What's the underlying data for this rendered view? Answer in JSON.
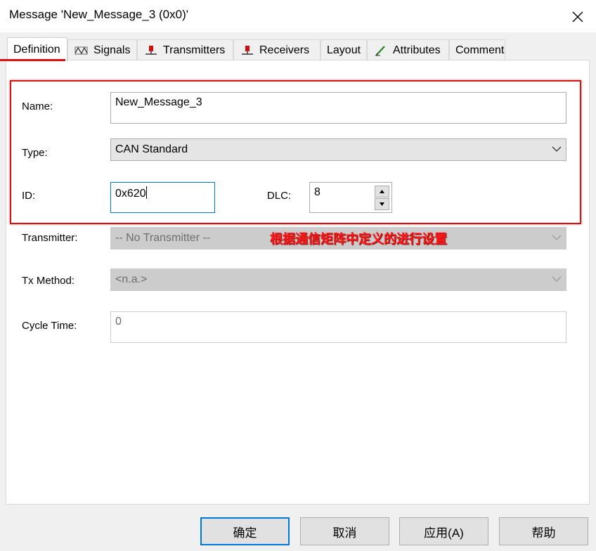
{
  "window": {
    "title": "Message 'New_Message_3 (0x0)'"
  },
  "tabs": [
    {
      "label": "Definition",
      "icon": "none"
    },
    {
      "label": "Signals",
      "icon": "signal-wave-icon"
    },
    {
      "label": "Transmitters",
      "icon": "ecu-node-red-icon"
    },
    {
      "label": "Receivers",
      "icon": "ecu-node-red-icon"
    },
    {
      "label": "Layout",
      "icon": "none"
    },
    {
      "label": "Attributes",
      "icon": "pencil-icon"
    },
    {
      "label": "Comment",
      "icon": "none"
    }
  ],
  "form": {
    "name_label": "Name:",
    "name_value": "New_Message_3",
    "type_label": "Type:",
    "type_value": "CAN Standard",
    "id_label": "ID:",
    "id_value": "0x620",
    "dlc_label": "DLC:",
    "dlc_value": "8",
    "transmitter_label": "Transmitter:",
    "transmitter_value": "-- No Transmitter --",
    "txmethod_label": "Tx Method:",
    "txmethod_value": "<n.a.>",
    "cycletime_label": "Cycle Time:",
    "cycletime_value": "0"
  },
  "annotation": {
    "text": "根据通信矩阵中定义的进行设置",
    "color": "#ff1a1a"
  },
  "buttons": {
    "ok": "确定",
    "cancel": "取消",
    "apply": "应用(A)",
    "help": "帮助"
  },
  "colors": {
    "accent": "#0078d7",
    "highlight_red": "#e01010"
  }
}
